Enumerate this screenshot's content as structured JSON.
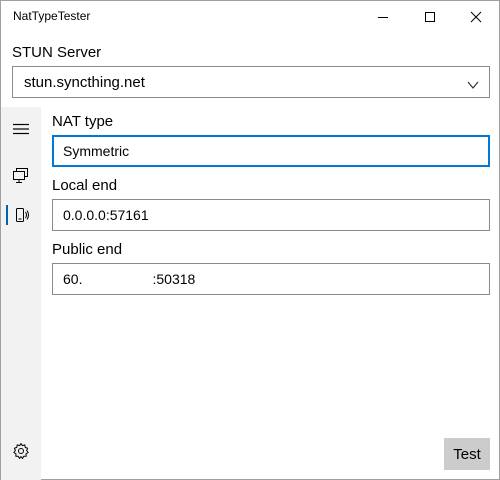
{
  "window": {
    "title": "NatTypeTester"
  },
  "server": {
    "label": "STUN Server",
    "value": "stun.syncthing.net"
  },
  "nav": {
    "icons": [
      "hamburger-icon",
      "monitor-icon",
      "device-icon",
      "settings-icon"
    ],
    "selected": "device",
    "accent": "#0063b1"
  },
  "fields": {
    "nat_type": {
      "label": "NAT type",
      "value": "Symmetric"
    },
    "local_end": {
      "label": "Local end",
      "value": "0.0.0.0:57161"
    },
    "public_end": {
      "label": "Public end",
      "value": "60.                  :50318"
    }
  },
  "actions": {
    "test_label": "Test"
  },
  "colors": {
    "focus_border": "#0078d7",
    "sidebar_bg": "#f2f2f2",
    "button_bg": "#cccccc"
  }
}
